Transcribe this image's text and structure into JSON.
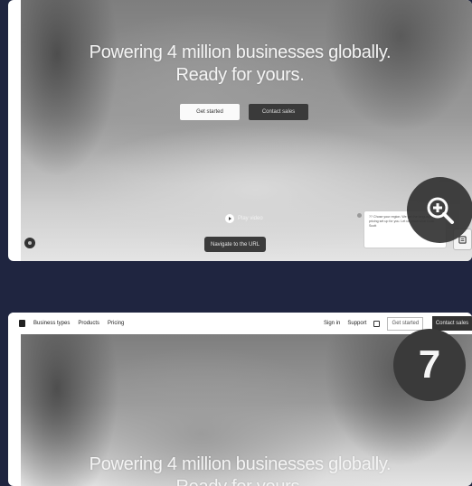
{
  "hero": {
    "headline_line1": "Powering 4 million businesses globally.",
    "headline_line2": "Ready for yours."
  },
  "buttons": {
    "get_started": "Get started",
    "contact_sales": "Contact sales"
  },
  "video": {
    "play_label": "Play video"
  },
  "tooltip": {
    "navigate": "Navigate to the URL"
  },
  "notification": {
    "text": "?? Chose your region. We get the language and pricing set up for you. Let us know what Dock Scott"
  },
  "nav": {
    "items": [
      "Business types",
      "Products",
      "Pricing"
    ],
    "sign_in": "Sign in",
    "support": "Support",
    "get_started": "Get started",
    "contact_sales": "Contact sales"
  },
  "step_badge": "7",
  "colors": {
    "page_bg": "#1f2540",
    "badge_bg": "#3a3a3a"
  }
}
